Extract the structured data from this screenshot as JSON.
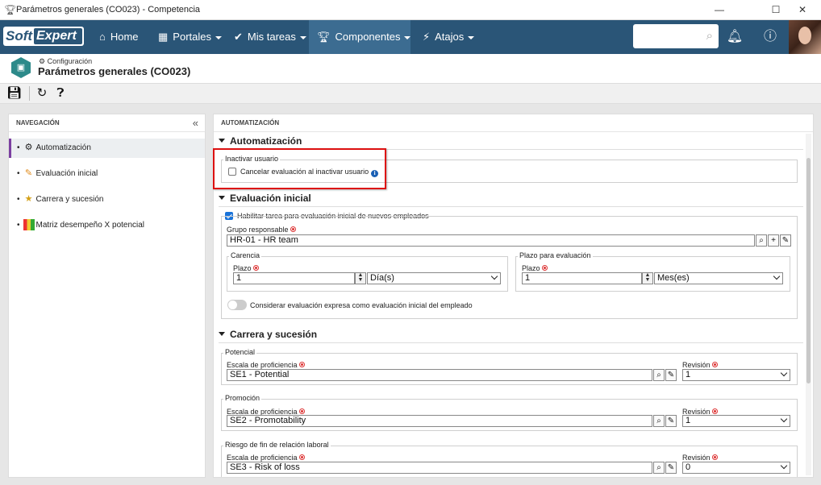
{
  "window": {
    "title": "Parámetros generales (CO023) - Competencia",
    "minimize": "—",
    "maximize": "☐",
    "close": "✕"
  },
  "topnav": {
    "logo_soft": "Soft",
    "logo_expert": "Expert",
    "items": [
      {
        "label": "Home",
        "icon": "home-icon"
      },
      {
        "label": "Portales",
        "icon": "grid-icon"
      },
      {
        "label": "Mis tareas",
        "icon": "check-icon"
      },
      {
        "label": "Componentes",
        "icon": "trophy-icon"
      },
      {
        "label": "Atajos",
        "icon": "bolt-icon"
      }
    ],
    "search_placeholder": ""
  },
  "header": {
    "breadcrumb": "Configuración",
    "title": "Parámetros generales (CO023)"
  },
  "navigation": {
    "title": "NAVEGACIÓN",
    "items": [
      {
        "label": "Automatización",
        "selected": true
      },
      {
        "label": "Evaluación inicial"
      },
      {
        "label": "Carrera y sucesión"
      },
      {
        "label": "Matriz desempeño X potencial"
      }
    ]
  },
  "main": {
    "panel_title": "AUTOMATIZACIÓN",
    "automatizacion": {
      "title": "Automatización",
      "group": "Inactivar usuario",
      "checkbox_label": "Cancelar evaluación al inactivar usuario",
      "checked": false
    },
    "evaluacion": {
      "title": "Evaluación inicial",
      "enable_label": "Habilitar tarea para evaluación inicial de nuevos empleados",
      "enable_checked": true,
      "group_label": "Grupo responsable",
      "group_value": "HR-01 - HR team",
      "carencia": {
        "legend": "Carencia",
        "plazo_label": "Plazo",
        "plazo_value": "1",
        "unit": "Día(s)"
      },
      "plazo_eval": {
        "legend": "Plazo para evaluación",
        "plazo_label": "Plazo",
        "plazo_value": "1",
        "unit": "Mes(es)"
      },
      "toggle_label": "Considerar evaluación expresa como evaluación inicial del empleado"
    },
    "carrera": {
      "title": "Carrera y sucesión",
      "groups": [
        {
          "legend": "Potencial",
          "scale_label": "Escala de proficiencia",
          "scale_value": "SE1 - Potential",
          "rev_label": "Revisión",
          "rev_value": "1"
        },
        {
          "legend": "Promoción",
          "scale_label": "Escala de proficiencia",
          "scale_value": "SE2 - Promotability",
          "rev_label": "Revisión",
          "rev_value": "1"
        },
        {
          "legend": "Riesgo de fin de relación laboral",
          "scale_label": "Escala de proficiencia",
          "scale_value": "SE3 - Risk of loss",
          "rev_label": "Revisión",
          "rev_value": "0"
        }
      ]
    }
  }
}
